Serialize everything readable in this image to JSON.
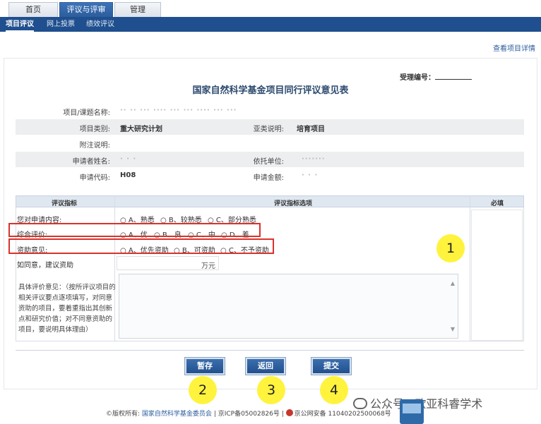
{
  "tabs": [
    {
      "label": "首页",
      "active": false
    },
    {
      "label": "评议与评审",
      "active": true
    },
    {
      "label": "管理",
      "active": false
    }
  ],
  "subnav": [
    {
      "label": "项目评议",
      "active": true
    },
    {
      "label": "网上投票",
      "active": false
    },
    {
      "label": "绩效评议",
      "active": false
    }
  ],
  "detail_link": "查看项目详情",
  "form": {
    "accept_label": "受理编号：",
    "title": "国家自然科学基金项目同行评议意见表",
    "info": {
      "project_name_label": "项目/课题名称:",
      "project_name_value": "·· ·· ··· ···· ··· ··· ···· ··· ···",
      "category_label": "项目类别:",
      "category_value": "重大研究计划",
      "subcategory_label": "亚类说明:",
      "subcategory_value": "培育项目",
      "note_label": "附注说明:",
      "applicant_label": "申请者姓名:",
      "applicant_value": "· · ·",
      "institution_label": "依托单位:",
      "institution_value": "·······",
      "code_label": "申请代码:",
      "code_value": "H08",
      "amount_label": "申请金额:",
      "amount_value": "· · ·"
    },
    "table": {
      "col_indicator": "评议指标",
      "col_options": "评议指标选项",
      "col_required": "必填",
      "rows": [
        {
          "label": "您对申请内容:",
          "options": [
            "A、熟悉",
            "B、较熟悉",
            "C、部分熟悉"
          ]
        },
        {
          "label": "综合评价:",
          "options": [
            "A、优",
            "B、良",
            "C、中",
            "D、差"
          ]
        },
        {
          "label": "资助意见:",
          "options": [
            "A、优先资助",
            "B、可资助",
            "C、不予资助"
          ]
        }
      ],
      "amount_label": "如同意，建议资助",
      "amount_unit": "万元",
      "comment_label": "具体评价意见：（按所评议项目的相关评议要点逐项填写，对同意资助的项目，要着重指出其创新点和研究价值；对不同意资助的项目，要说明具体理由）"
    }
  },
  "buttons": {
    "save": "暂存",
    "back": "返回",
    "submit": "提交"
  },
  "badges": [
    "1",
    "2",
    "3",
    "4"
  ],
  "footer": {
    "prefix": "©版权所有:",
    "owner": "国家自然科学基金委员会",
    "icp": "| 京ICP备05002826号 |",
    "police": "京公网安备 11040202500068号"
  },
  "watermark": "公众号 · 欧亚科睿学术"
}
